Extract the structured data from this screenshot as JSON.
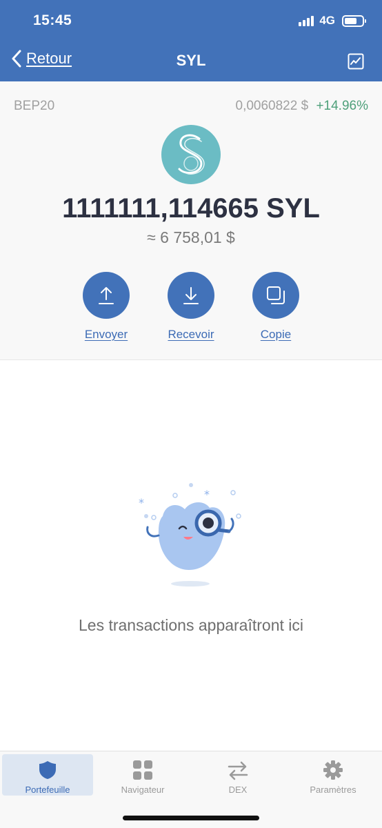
{
  "status_bar": {
    "time": "15:45",
    "network": "4G"
  },
  "nav": {
    "back_label": "Retour",
    "title": "SYL",
    "chart_icon": "chart-icon"
  },
  "token": {
    "network": "BEP20",
    "price": "0,0060822 $",
    "change": "+14.96%",
    "balance": "1111111,114665 SYL",
    "fiat_value": "≈ 6 758,01 $",
    "logo_icon": "token-logo-s",
    "change_color": "#4ea07a"
  },
  "actions": [
    {
      "label": "Envoyer",
      "icon": "upload-icon"
    },
    {
      "label": "Recevoir",
      "icon": "download-icon"
    },
    {
      "label": "Copie",
      "icon": "copy-icon"
    }
  ],
  "empty_state": {
    "message": "Les transactions apparaîtront ici",
    "illustration": "magnifier-mascot"
  },
  "tabs": [
    {
      "label": "Portefeuille",
      "icon": "shield-icon",
      "active": true
    },
    {
      "label": "Navigateur",
      "icon": "grid-icon",
      "active": false
    },
    {
      "label": "DEX",
      "icon": "swap-icon",
      "active": false
    },
    {
      "label": "Paramètres",
      "icon": "gear-icon",
      "active": false
    }
  ],
  "colors": {
    "primary": "#4272b9",
    "panel": "#f8f8f8",
    "positive": "#4ea07a"
  }
}
